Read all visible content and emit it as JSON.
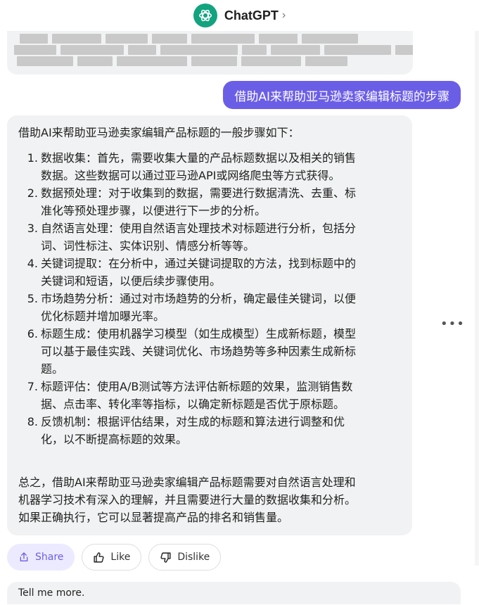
{
  "header": {
    "title": "ChatGPT",
    "chevron": "›",
    "logo_icon": "openai-logo-icon"
  },
  "user_message": "借助AI来帮助亚马逊卖家编辑标题的步骤",
  "assistant_message": {
    "intro": "借助AI来帮助亚马逊卖家编辑产品标题的一般步骤如下：",
    "steps": [
      {
        "num": "1.",
        "lines": [
          "数据收集：首先，需要收集大量的产品标题数据以及相关的销售",
          "数据。这些数据可以通过亚马逊API或网络爬虫等方式获得。"
        ]
      },
      {
        "num": "2.",
        "lines": [
          "数据预处理：对于收集到的数据，需要进行数据清洗、去重、标",
          "准化等预处理步骤，以便进行下一步的分析。"
        ]
      },
      {
        "num": "3.",
        "lines": [
          "自然语言处理：使用自然语言处理技术对标题进行分析，包括分",
          "词、词性标注、实体识别、情感分析等等。"
        ]
      },
      {
        "num": "4.",
        "lines": [
          "关键词提取：在分析中，通过关键词提取的方法，找到标题中的",
          "关键词和短语，以便后续步骤使用。"
        ]
      },
      {
        "num": "5.",
        "lines": [
          "市场趋势分析：通过对市场趋势的分析，确定最佳关键词，以便",
          "优化标题并增加曝光率。"
        ]
      },
      {
        "num": "6.",
        "lines": [
          "标题生成：使用机器学习模型（如生成模型）生成新标题，模型",
          "可以基于最佳实践、关键词优化、市场趋势等多种因素生成新标",
          "题。"
        ]
      },
      {
        "num": "7.",
        "lines": [
          "标题评估：使用A/B测试等方法评估新标题的效果，监测销售数",
          "据、点击率、转化率等指标，以确定新标题是否优于原标题。"
        ]
      },
      {
        "num": "8.",
        "lines": [
          "反馈机制：根据评估结果，对生成的标题和算法进行调整和优",
          "化，以不断提高标题的效果。"
        ]
      }
    ],
    "summary_lines": [
      "总之，借助AI来帮助亚马逊卖家编辑产品标题需要对自然语言处理和",
      "机器学习技术有深入的理解，并且需要进行大量的数据收集和分析。",
      "如果正确执行，它可以显著提高产品的排名和销售量。"
    ]
  },
  "actions": {
    "share_label": "Share",
    "like_label": "Like",
    "dislike_label": "Dislike",
    "more_label": "•••"
  },
  "suggestion": "Tell me more.",
  "colors": {
    "accent": "#6b5ee6",
    "logo_green": "#13a37f",
    "bubble_gray": "#f1f2f3"
  }
}
